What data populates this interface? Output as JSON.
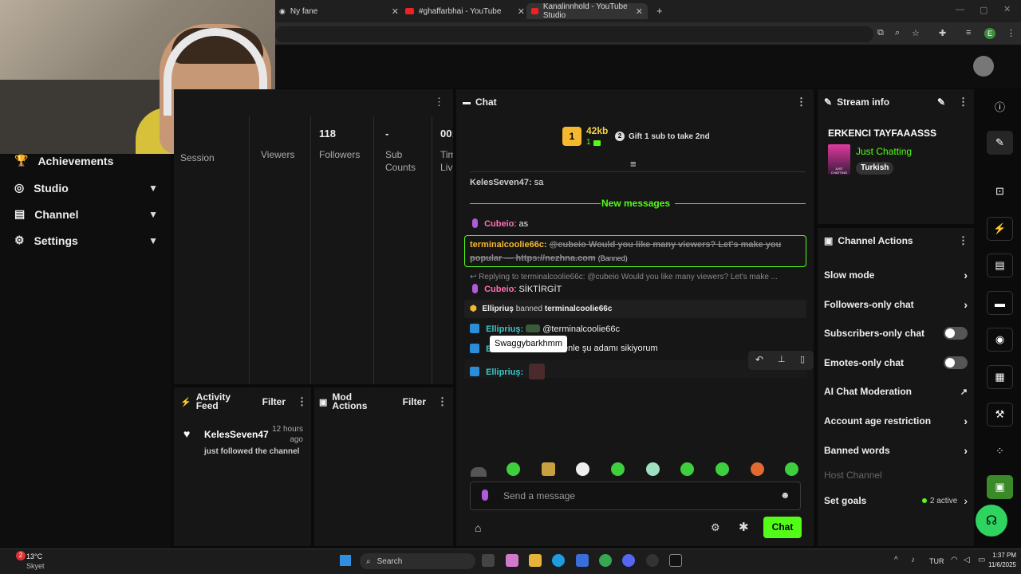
{
  "browser": {
    "tabs": [
      {
        "label": "Ny fane"
      },
      {
        "label": "#ghaffarbhai - YouTube"
      },
      {
        "label": "Kanalinnhold - YouTube Studio"
      }
    ],
    "new_tab": "+",
    "profile_initial": "E"
  },
  "nav": {
    "items": [
      {
        "label": "Achievements",
        "icon": "trophy-icon"
      },
      {
        "label": "Studio",
        "icon": "studio-icon"
      },
      {
        "label": "Channel",
        "icon": "channel-icon"
      },
      {
        "label": "Settings",
        "icon": "gear-icon"
      }
    ]
  },
  "stats": {
    "cols": [
      {
        "value": "",
        "label": "Session"
      },
      {
        "value": "",
        "label": "Viewers"
      },
      {
        "value": "118",
        "label": "Followers"
      },
      {
        "value": "-",
        "label": "Sub Counts"
      },
      {
        "value": "00:",
        "label": "Tim Liv"
      }
    ]
  },
  "activity": {
    "title": "Activity Feed",
    "filter": "Filter",
    "item": {
      "user": "KelesSeven47",
      "time": "12 hours ago",
      "text": "just followed the channel"
    }
  },
  "mod": {
    "title": "Mod Actions",
    "filter": "Filter"
  },
  "chat": {
    "title": "Chat",
    "hype_amount": "42kb",
    "hype_count": "1",
    "gift_rank": "2",
    "gift_text": "Gift 1 sub to take 2nd",
    "new_messages": "New messages",
    "messages": {
      "m1_user": "KelesSeven47:",
      "m1_text": "sa",
      "m2_user": "Cubeio",
      "m2_text": ": as",
      "m3_user": "terminalcoolie66c:",
      "m3_text": "@cubeio Would you like many viewers? Let's make you popular — https://nezhna.com",
      "m3_tag": "(Banned)",
      "reply_text": "Replying to terminalcoolie66c: @cubeio Would you like many viewers? Let's make ...",
      "m4_user": "Cubeio",
      "m4_text": ": SİKTİRGİT",
      "ban_user": "Ellipriuş",
      "ban_text": "banned",
      "ban_target": "terminalcoolie66c",
      "m5_user": "Ellipriuş:",
      "m5_text": "@terminalcoolie66c",
      "m6_user": "El",
      "m6_text": "enle şu adamı sikiyorum",
      "m7_user": "Ellipriuş:"
    },
    "tooltip": "Swaggybarkhmm",
    "input_placeholder": "Send a message",
    "send_button": "Chat"
  },
  "stream_info": {
    "title": "Stream info",
    "stream_title": "ERKENCI TAYFAAASSS",
    "category": "Just Chatting",
    "language_tag": "Turkish",
    "box_art_text": "JUST CHATTING"
  },
  "channel_actions": {
    "title": "Channel Actions",
    "items": [
      {
        "label": "Slow mode"
      },
      {
        "label": "Followers-only chat"
      },
      {
        "label": "Subscribers-only chat"
      },
      {
        "label": "Emotes-only chat"
      },
      {
        "label": "AI Chat Moderation"
      },
      {
        "label": "Account age restriction"
      },
      {
        "label": "Banned words"
      },
      {
        "label": "Host Channel"
      },
      {
        "label": "Set goals"
      }
    ],
    "goals_status": "2 active"
  },
  "taskbar": {
    "weather_temp": "13°C",
    "weather_desc": "Skyet",
    "weather_badge": "2",
    "search_placeholder": "Search",
    "lang": "TUR",
    "time": "1:37 PM",
    "date": "11/6/2025"
  },
  "colors": {
    "accent": "#53fc18",
    "panel": "#161616",
    "bg": "#0b0b0b"
  }
}
